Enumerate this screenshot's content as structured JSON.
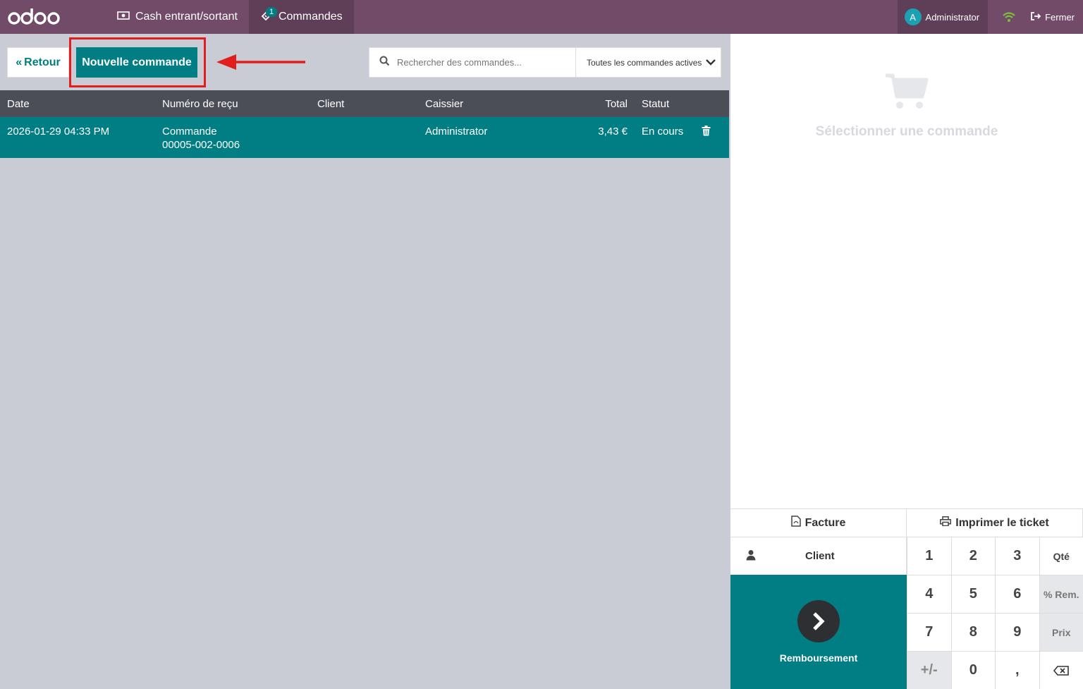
{
  "topbar": {
    "logo_text": "odoo",
    "nav": [
      {
        "label": "Cash entrant/sortant"
      },
      {
        "label": "Commandes",
        "badge": "1"
      }
    ],
    "user": {
      "initial": "A",
      "name": "Administrator"
    },
    "close_label": "Fermer"
  },
  "toolbar": {
    "back_label": "Retour",
    "new_order_label": "Nouvelle commande",
    "search_placeholder": "Rechercher des commandes...",
    "filter_label": "Toutes les commandes actives"
  },
  "table": {
    "headers": {
      "date": "Date",
      "recu": "Numéro de reçu",
      "client": "Client",
      "caissier": "Caissier",
      "total": "Total",
      "statut": "Statut"
    },
    "rows": [
      {
        "date": "2026-01-29 04:33 PM",
        "recu_line1": "Commande",
        "recu_line2": "00005-002-0006",
        "client": "",
        "caissier": "Administrator",
        "total": "3,43 €",
        "statut": "En cours"
      }
    ]
  },
  "detail": {
    "empty_text": "Sélectionner une commande"
  },
  "pad": {
    "invoice_label": "Facture",
    "print_label": "Imprimer le ticket",
    "client_label": "Client",
    "refund_label": "Remboursement",
    "keys": [
      "1",
      "2",
      "3",
      "Qté",
      "4",
      "5",
      "6",
      "% Rem.",
      "7",
      "8",
      "9",
      "Prix",
      "+/-",
      "0",
      ","
    ]
  },
  "colors": {
    "topbar": "#714b67",
    "accent": "#017e84",
    "highlight": "#e01e1e"
  }
}
